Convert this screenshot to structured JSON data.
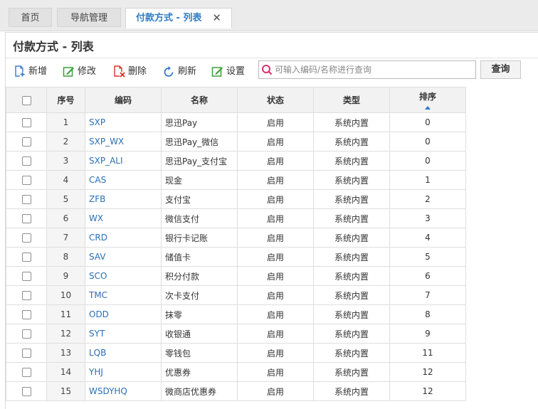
{
  "tabs": [
    {
      "label": "首页"
    },
    {
      "label": "导航管理"
    },
    {
      "label": "付款方式 - 列表",
      "close": "✕"
    }
  ],
  "page": {
    "title": "付款方式 - 列表"
  },
  "toolbar": {
    "add": "新增",
    "edit": "修改",
    "delete": "删除",
    "refresh": "刷新",
    "settings": "设置"
  },
  "search": {
    "placeholder": "可输入编码/名称进行查询",
    "value": "",
    "button": "查询"
  },
  "colors": {
    "accent": "#2f7bc4",
    "link": "#2a6fb5",
    "tab_bar": "#ebebeb"
  },
  "table": {
    "headers": {
      "seq": "序号",
      "code": "编码",
      "name": "名称",
      "status": "状态",
      "type": "类型",
      "sort": "排序"
    },
    "sort_state": "ascending",
    "rows": [
      {
        "seq": "1",
        "code": "SXP",
        "name": "思迅Pay",
        "status": "启用",
        "type": "系统内置",
        "sort": "0"
      },
      {
        "seq": "2",
        "code": "SXP_WX",
        "name": "思迅Pay_微信",
        "status": "启用",
        "type": "系统内置",
        "sort": "0"
      },
      {
        "seq": "3",
        "code": "SXP_ALI",
        "name": "思迅Pay_支付宝",
        "status": "启用",
        "type": "系统内置",
        "sort": "0"
      },
      {
        "seq": "4",
        "code": "CAS",
        "name": "现金",
        "status": "启用",
        "type": "系统内置",
        "sort": "1"
      },
      {
        "seq": "5",
        "code": "ZFB",
        "name": "支付宝",
        "status": "启用",
        "type": "系统内置",
        "sort": "2"
      },
      {
        "seq": "6",
        "code": "WX",
        "name": "微信支付",
        "status": "启用",
        "type": "系统内置",
        "sort": "3"
      },
      {
        "seq": "7",
        "code": "CRD",
        "name": "银行卡记账",
        "status": "启用",
        "type": "系统内置",
        "sort": "4"
      },
      {
        "seq": "8",
        "code": "SAV",
        "name": "储值卡",
        "status": "启用",
        "type": "系统内置",
        "sort": "5"
      },
      {
        "seq": "9",
        "code": "SCO",
        "name": "积分付款",
        "status": "启用",
        "type": "系统内置",
        "sort": "6"
      },
      {
        "seq": "10",
        "code": "TMC",
        "name": "次卡支付",
        "status": "启用",
        "type": "系统内置",
        "sort": "7"
      },
      {
        "seq": "11",
        "code": "ODD",
        "name": "抹零",
        "status": "启用",
        "type": "系统内置",
        "sort": "8"
      },
      {
        "seq": "12",
        "code": "SYT",
        "name": "收银通",
        "status": "启用",
        "type": "系统内置",
        "sort": "9"
      },
      {
        "seq": "13",
        "code": "LQB",
        "name": "零钱包",
        "status": "启用",
        "type": "系统内置",
        "sort": "11"
      },
      {
        "seq": "14",
        "code": "YHJ",
        "name": "优惠券",
        "status": "启用",
        "type": "系统内置",
        "sort": "12"
      },
      {
        "seq": "15",
        "code": "WSDYHQ",
        "name": "微商店优惠券",
        "status": "启用",
        "type": "系统内置",
        "sort": "12"
      }
    ]
  }
}
